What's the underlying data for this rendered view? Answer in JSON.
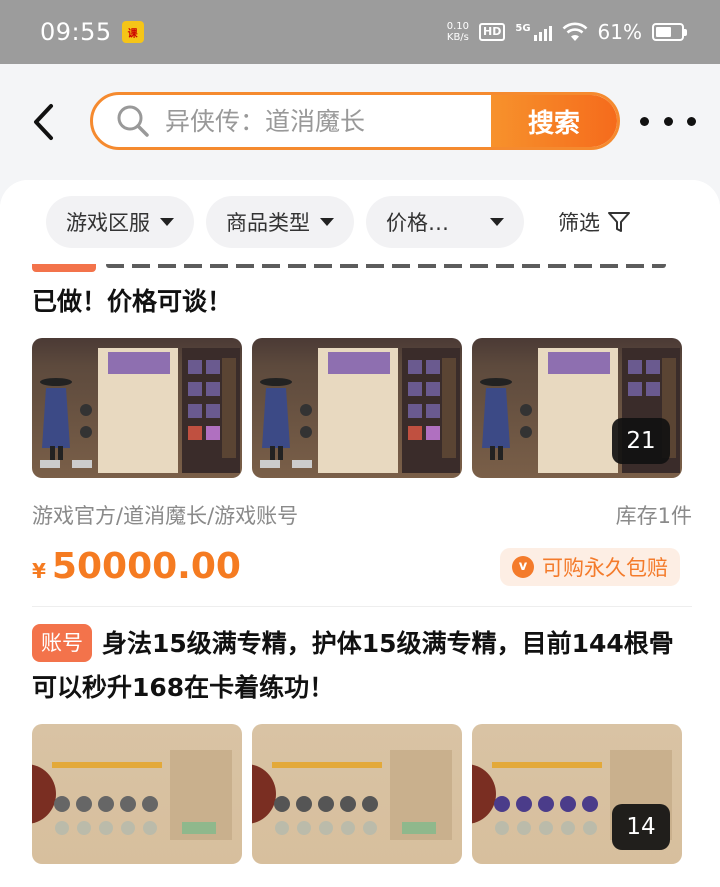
{
  "status_bar": {
    "time": "09:55",
    "app_badge": "课",
    "net_speed_value": "0.10",
    "net_speed_unit": "KB/s",
    "hd": "HD",
    "network": "5G",
    "battery": "61%",
    "battery_level": 0.61
  },
  "header": {
    "search_placeholder": "异侠传：道消魔长",
    "search_button": "搜索"
  },
  "filters": {
    "server": "游戏区服",
    "category": "商品类型",
    "price": "价格…",
    "filter": "筛选"
  },
  "listings": [
    {
      "title_visible": "已做！价格可谈！",
      "image_count": "21",
      "path": "游戏官方/道消魔长/游戏账号",
      "stock": "库存1件",
      "currency": "¥",
      "price": "50000.00",
      "guarantee": "可购永久包赔",
      "guarantee_icon": "v"
    },
    {
      "tag": "账号",
      "title": "身法15级满专精，护体15级满专精，目前144根骨可以秒升168在卡着练功！",
      "image_count": "14"
    }
  ],
  "colors": {
    "accent": "#f58a2f",
    "tag": "#f3734b",
    "price": "#f57b21"
  }
}
